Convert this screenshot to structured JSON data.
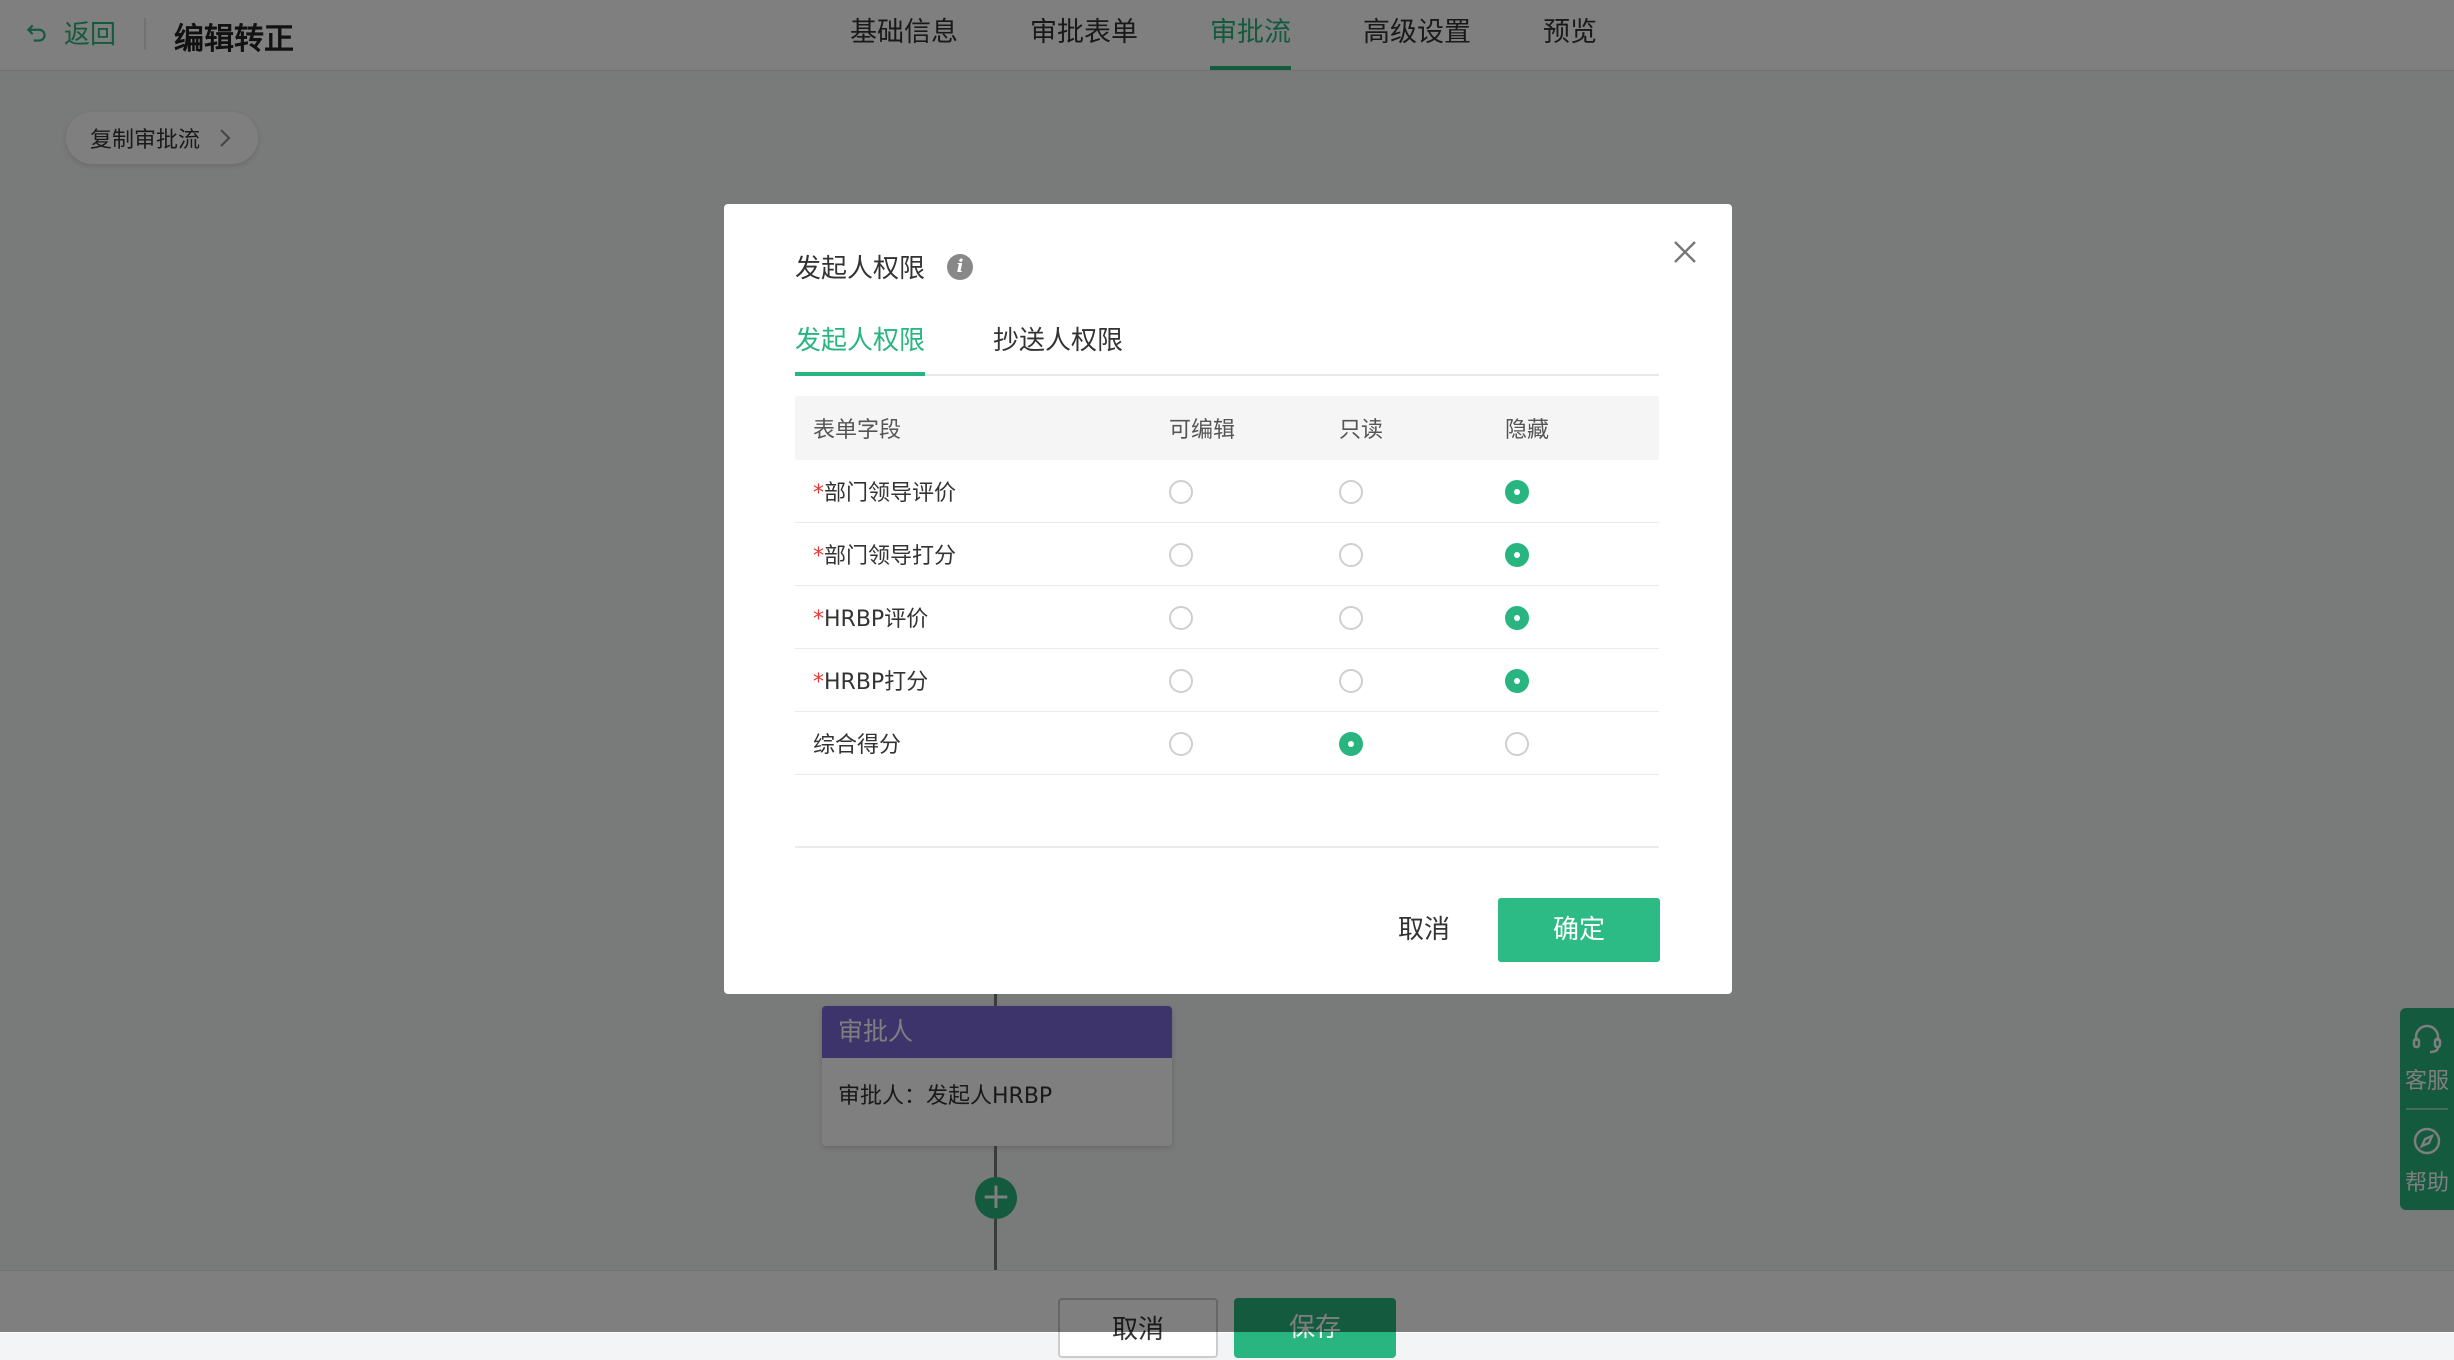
{
  "header": {
    "back_label": "返回",
    "title": "编辑转正",
    "tabs": [
      {
        "label": "基础信息",
        "active": false
      },
      {
        "label": "审批表单",
        "active": false
      },
      {
        "label": "审批流",
        "active": true
      },
      {
        "label": "高级设置",
        "active": false
      },
      {
        "label": "预览",
        "active": false
      }
    ]
  },
  "canvas": {
    "copy_flow_label": "复制审批流",
    "approver_card": {
      "title": "审批人",
      "body": "审批人：发起人HRBP"
    },
    "add_node_symbol": "+"
  },
  "footer": {
    "cancel_label": "取消",
    "save_label": "保存"
  },
  "side_help": {
    "service_label": "客服",
    "help_label": "帮助"
  },
  "modal": {
    "title": "发起人权限",
    "info_icon_glyph": "i",
    "tabs": [
      {
        "label": "发起人权限",
        "active": true
      },
      {
        "label": "抄送人权限",
        "active": false
      }
    ],
    "columns": {
      "field": "表单字段",
      "editable": "可编辑",
      "readonly": "只读",
      "hidden": "隐藏"
    },
    "required_mark": "*",
    "rows": [
      {
        "field": "部门领导评价",
        "required": true,
        "selected": "hidden"
      },
      {
        "field": "部门领导打分",
        "required": true,
        "selected": "hidden"
      },
      {
        "field": "HRBP评价",
        "required": true,
        "selected": "hidden"
      },
      {
        "field": "HRBP打分",
        "required": true,
        "selected": "hidden"
      },
      {
        "field": "综合得分",
        "required": false,
        "selected": "readonly"
      }
    ],
    "cancel_label": "取消",
    "confirm_label": "确定"
  },
  "colors": {
    "accent": "#28b57f",
    "approver_header": "#7b68d8",
    "required": "#e53935"
  }
}
